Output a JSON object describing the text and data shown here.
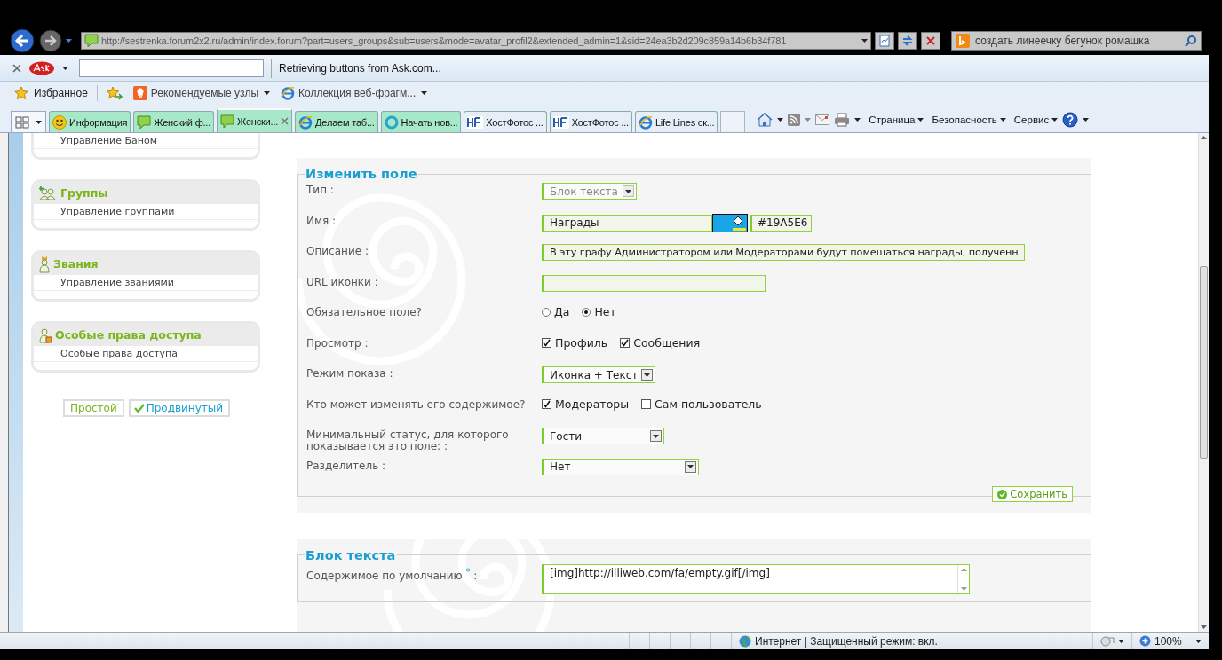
{
  "address_bar": {
    "url": "http://sestrenka.forum2x2.ru/admin/index.forum?part=users_groups&sub=users&mode=avatar_profil2&extended_admin=1&sid=24ea3b2d209c859a14b6b34f781"
  },
  "search": {
    "value": "создать линеечку бегунок ромашка"
  },
  "ask_toolbar": {
    "status": "Retrieving buttons from Ask.com..."
  },
  "favorites_bar": {
    "label": "Избранное",
    "links": [
      {
        "label": "Рекомендуемые узлы",
        "kind": "suggested"
      },
      {
        "label": "Коллекция веб-фрагм...",
        "kind": "ie"
      }
    ]
  },
  "tabs": [
    {
      "label": "Информация",
      "kind": "smiley",
      "selected": false,
      "color": "#a6e8c8"
    },
    {
      "label": "Женский ф...",
      "kind": "bubble",
      "selected": false,
      "color": "#a6e8c8"
    },
    {
      "label": "Женски...",
      "kind": "bubble",
      "selected": true,
      "color": "#a6e8c8"
    },
    {
      "label": "Делаем таб...",
      "kind": "ie",
      "selected": false,
      "color": "#a6e8c8"
    },
    {
      "label": "Начать нов...",
      "kind": "loading",
      "selected": false,
      "color": "#a6e8c8"
    },
    {
      "label": "ХостФотос ...",
      "kind": "hf",
      "selected": false,
      "color": "#e6eef8"
    },
    {
      "label": "ХостФотос ...",
      "kind": "hf",
      "selected": false,
      "color": "#e6eef8"
    },
    {
      "label": "Life Lines ск...",
      "kind": "ie",
      "selected": false,
      "color": "#e6eef8"
    }
  ],
  "command_bar": {
    "menus": [
      "Страница",
      "Безопасность",
      "Сервис"
    ]
  },
  "sidebar": {
    "partial_group": {
      "items": [
        "Управление Баном"
      ]
    },
    "groups": [
      {
        "title": "Группы",
        "kind": "groups",
        "items": [
          "Управление группами"
        ]
      },
      {
        "title": "Звания",
        "kind": "ranks",
        "items": [
          "Управление званиями"
        ]
      },
      {
        "title": "Особые права доступа",
        "kind": "permissions",
        "items": [
          "Особые права доступа"
        ]
      }
    ],
    "mode_buttons": [
      {
        "label": "Простой",
        "selected": false
      },
      {
        "label": "Продвинутый",
        "selected": true
      }
    ]
  },
  "edit_field": {
    "title": "Изменить поле",
    "rows": [
      {
        "kind": "select",
        "label": "Тип :",
        "value": "Блок текста",
        "disabled": true
      },
      {
        "kind": "color_text",
        "label": "Имя :",
        "value": "Награды",
        "color": "#19a5e6",
        "hex": "#19A5E6"
      },
      {
        "kind": "text",
        "label": "Описание :",
        "value": "В эту графу Администратором или Модераторами будут помещаться награды, полученн"
      },
      {
        "kind": "text",
        "label": "URL иконки :"
      },
      {
        "kind": "radio",
        "label": "Обязательное поле?",
        "options": [
          {
            "label": "Да",
            "selected": false
          },
          {
            "label": "Нет",
            "selected": true
          }
        ]
      },
      {
        "kind": "checkbox",
        "label": "Просмотр :",
        "options": [
          {
            "label": "Профиль",
            "checked": true
          },
          {
            "label": "Сообщения",
            "checked": true
          }
        ]
      },
      {
        "kind": "select",
        "label": "Режим показа :",
        "value": "Иконка + Текст",
        "disabled": false
      },
      {
        "kind": "checkbox",
        "label": "Кто может изменять его содержимое?",
        "options": [
          {
            "label": "Модераторы",
            "checked": true
          },
          {
            "label": "Сам пользователь",
            "checked": false
          }
        ]
      },
      {
        "kind": "select",
        "label": "Минимальный статус, для которого показывается это поле: :",
        "value": "Гости",
        "disabled": false
      },
      {
        "kind": "select",
        "label": "Разделитель :",
        "value": "Нет",
        "disabled": false
      }
    ],
    "save_button": "Сохранить"
  },
  "text_block": {
    "title": "Блок текста",
    "rows": [
      {
        "kind": "textarea",
        "label": "Содержимое по умолчанию $^{*}$ :",
        "value": "[img]http://illiweb.com/fa/empty.gif[/img]"
      }
    ]
  },
  "status_bar": {
    "text": "Интернет | Защищенный режим: вкл.",
    "zoom": "100%"
  }
}
